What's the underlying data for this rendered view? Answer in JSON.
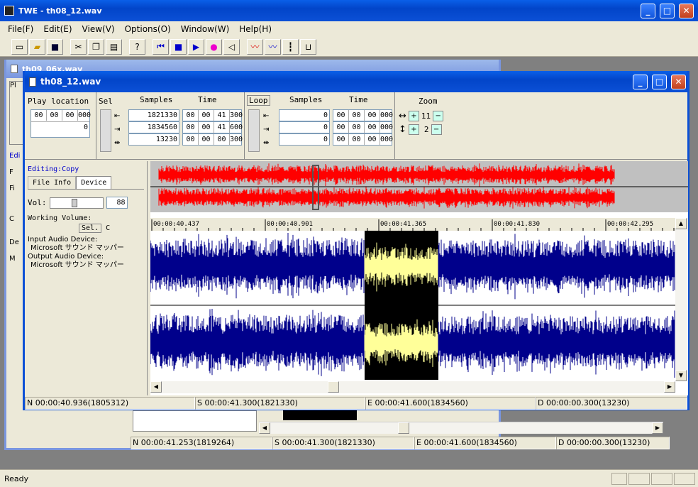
{
  "app": {
    "title": "TWE - th08_12.wav",
    "min": "_",
    "max": "□",
    "close": "✕"
  },
  "menu": [
    "File(F)",
    "Edit(E)",
    "View(V)",
    "Options(O)",
    "Window(W)",
    "Help(H)"
  ],
  "toolbar": {
    "help": "?"
  },
  "bg_window": {
    "title": "th09_06x.wav",
    "status": [
      "N 00:00:41.253(1819264)",
      "S 00:00:41.300(1821330)",
      "E 00:00:41.600(1834560)",
      "D 00:00:00.300(13230)"
    ],
    "left_labels": [
      "Pl",
      "Edi",
      "F",
      "Fi",
      "C",
      "De",
      "M"
    ]
  },
  "doc": {
    "title": "th08_12.wav",
    "play_location": {
      "label": "Play location",
      "time": [
        "00",
        "00",
        "00",
        "000"
      ],
      "samples": "0"
    },
    "sel": {
      "label": "Sel",
      "samples_label": "Samples",
      "time_label": "Time",
      "rows": [
        {
          "samples": "1821330",
          "time": [
            "00",
            "00",
            "41",
            "300"
          ]
        },
        {
          "samples": "1834560",
          "time": [
            "00",
            "00",
            "41",
            "600"
          ]
        },
        {
          "samples": "13230",
          "time": [
            "00",
            "00",
            "00",
            "300"
          ]
        }
      ]
    },
    "loop": {
      "label": "Loop",
      "samples_label": "Samples",
      "time_label": "Time",
      "rows": [
        {
          "samples": "0",
          "time": [
            "00",
            "00",
            "00",
            "000"
          ]
        },
        {
          "samples": "0",
          "time": [
            "00",
            "00",
            "00",
            "000"
          ]
        },
        {
          "samples": "0",
          "time": [
            "00",
            "00",
            "00",
            "000"
          ]
        }
      ]
    },
    "zoom": {
      "label": "Zoom",
      "h": "11",
      "v": "2"
    },
    "editing": "Editing:Copy",
    "tabs": [
      "File Info",
      "Device"
    ],
    "vol_label": "Vol:",
    "vol_value": "88",
    "working_volume": "Working Volume:",
    "sel_btn": "Sel.",
    "sel_c": "C",
    "input_device_label": "Input Audio Device:",
    "input_device": "Microsoft サウンド マッパー",
    "output_device_label": "Output Audio Device:",
    "output_device": "Microsoft サウンド マッパー",
    "ruler": [
      "00:00:40.437",
      "00:00:40.901",
      "00:00:41.365",
      "00:00:41.830",
      "00:00:42.295"
    ],
    "status": [
      "N 00:00:40.936(1805312)",
      "S 00:00:41.300(1821330)",
      "E 00:00:41.600(1834560)",
      "D 00:00:00.300(13230)"
    ]
  },
  "main_status": "Ready",
  "colors": {
    "overview": "#ff0000",
    "wave": "#00008b",
    "selection_bg": "#000000",
    "selection_wave": "#ffff99"
  }
}
